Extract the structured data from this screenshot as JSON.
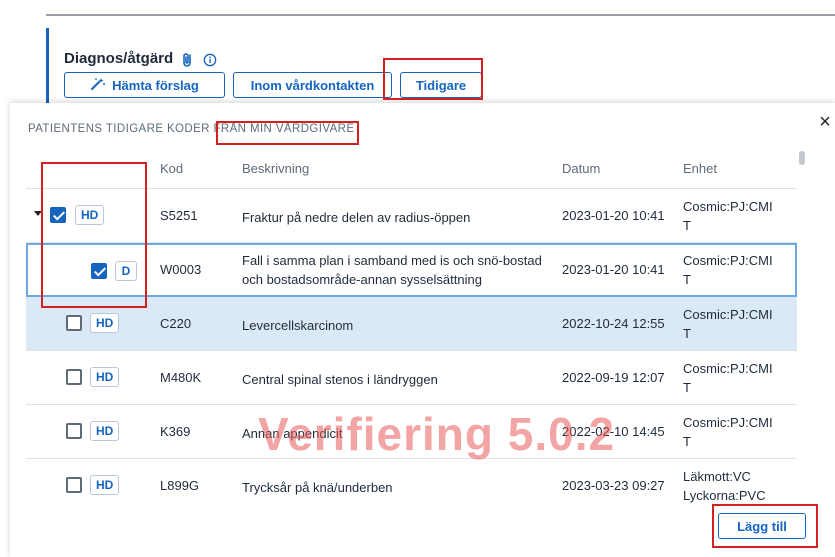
{
  "section": {
    "title": "Diagnos/åtgärd",
    "buttons": {
      "suggest": "Hämta förslag",
      "within_contact": "Inom vårdkontakten",
      "earlier": "Tidigare"
    }
  },
  "panel": {
    "title": "PATIENTENS TIDIGARE KODER FRÅN MIN VÅRDGIVARE",
    "close": "×",
    "add_button": "Lägg till"
  },
  "table": {
    "headers": {
      "kod": "Kod",
      "desc": "Beskrivning",
      "date": "Datum",
      "unit": "Enhet"
    },
    "rows": [
      {
        "checked": true,
        "expandable": true,
        "tag": "HD",
        "kod": "S5251",
        "desc": "Fraktur på nedre delen av radius-öppen",
        "date": "2023-01-20 10:41",
        "unit": "Cosmic:PJ:CMI T"
      },
      {
        "checked": true,
        "child": true,
        "tag": "D",
        "kod": "W0003",
        "desc": "Fall i samma plan i samband med is och snö-bostad och bostadsområde-annan sysselsättning",
        "date": "2023-01-20 10:41",
        "unit": "Cosmic:PJ:CMI T"
      },
      {
        "checked": false,
        "tag": "HD",
        "kod": "C220",
        "desc": "Levercellskarcinom",
        "date": "2022-10-24 12:55",
        "unit": "Cosmic:PJ:CMI T"
      },
      {
        "checked": false,
        "tag": "HD",
        "kod": "M480K",
        "desc": "Central spinal stenos i ländryggen",
        "date": "2022-09-19 12:07",
        "unit": "Cosmic:PJ:CMI T"
      },
      {
        "checked": false,
        "tag": "HD",
        "kod": "K369",
        "desc": "Annan appendicit",
        "date": "2022-02-10 14:45",
        "unit": "Cosmic:PJ:CMI T"
      },
      {
        "checked": false,
        "tag": "HD",
        "kod": "L899G",
        "desc": "Trycksår på knä/underben",
        "date": "2023-03-23 09:27",
        "unit": "Läkmott:VC Lyckorna:PVC"
      }
    ]
  },
  "watermark": "Verifiering 5.0.2",
  "colors": {
    "accent": "#1565c0",
    "highlight": "#dbe8f5",
    "selected_border": "#6ea8df",
    "annotation": "#d32020",
    "watermark": "#e95a5a"
  },
  "icons": [
    "paperclip-icon",
    "info-icon",
    "magic-wand-icon",
    "close-icon",
    "checkbox-icon",
    "caret-down-icon"
  ]
}
